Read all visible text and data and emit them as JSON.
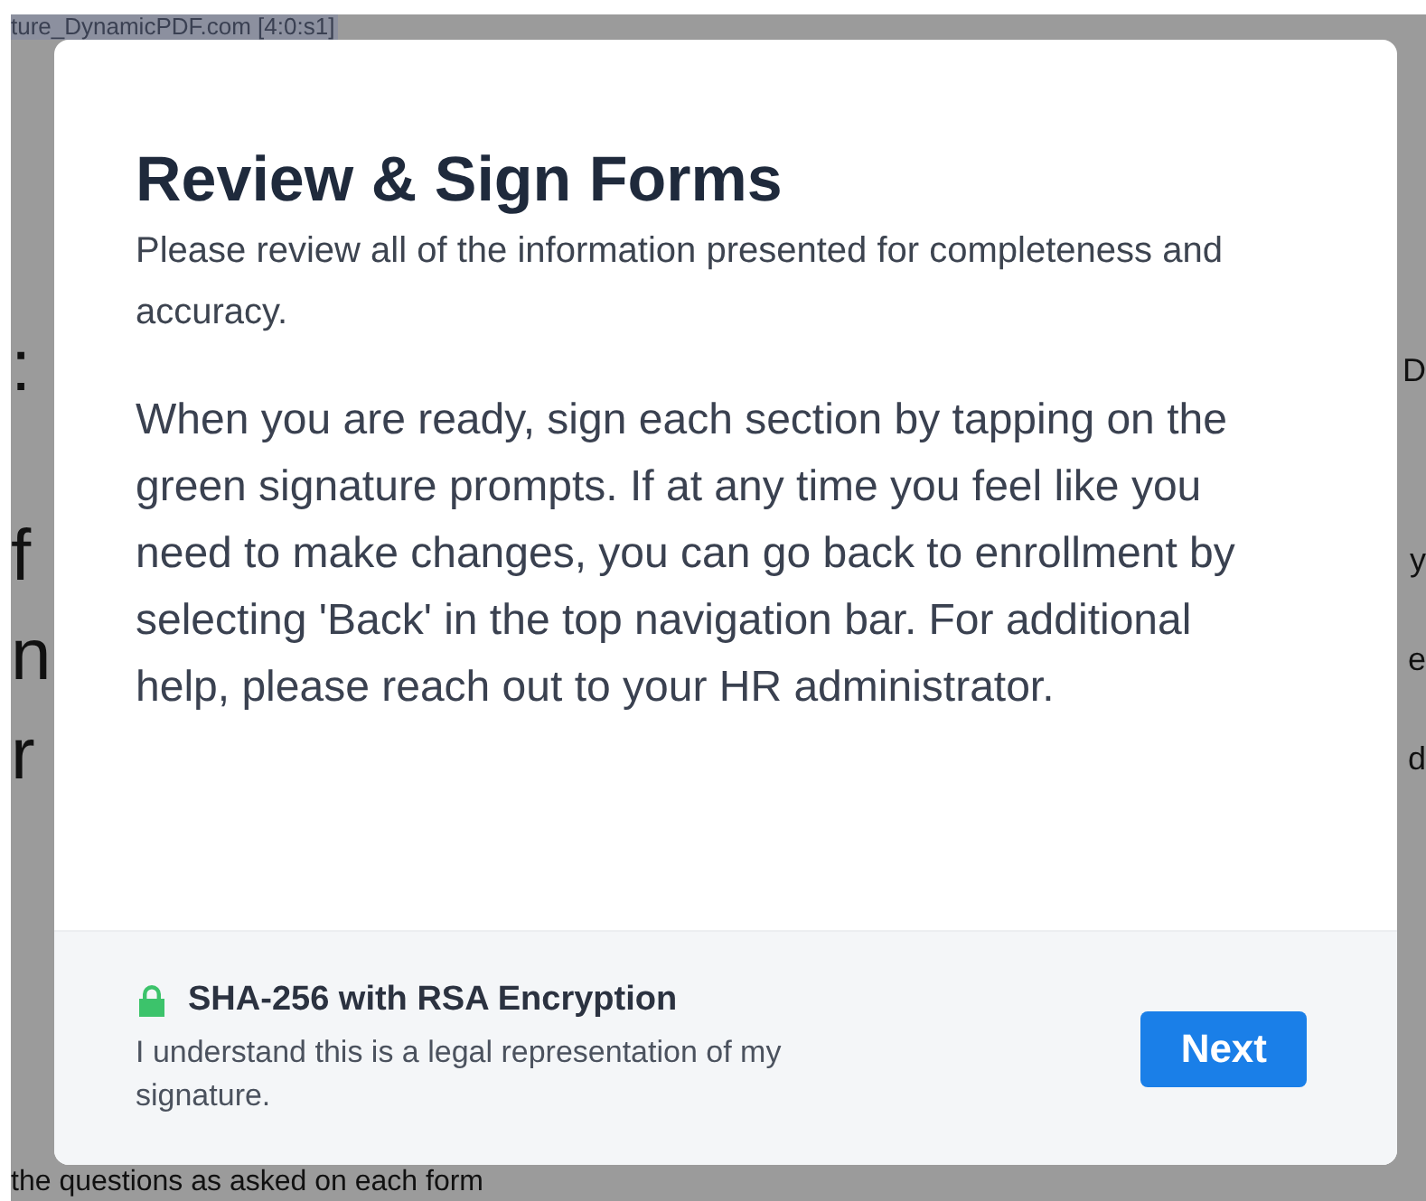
{
  "background": {
    "header": "ture_DynamicPDF.com [4:0:s1]",
    "fragments": [
      {
        "left": ":",
        "right": "D"
      },
      {
        "left": "f",
        "right": "y"
      },
      {
        "left": "n",
        "right": "e"
      },
      {
        "left": "r",
        "right": "d"
      }
    ],
    "bottom_line": "the questions as asked on each form"
  },
  "dialog": {
    "title": "Review & Sign Forms",
    "intro": "Please review all of the information presented for completeness and accuracy.",
    "body": "When you are ready, sign each section by tapping on the green signature prompts. If at any time you feel like you need to make changes, you can go back to enrollment by selecting 'Back' in the top navigation bar. For additional help, please reach out to your HR administrator.",
    "footer": {
      "security": "SHA-256 with RSA Encryption",
      "consent": "I understand this is a legal representation of my signature.",
      "button": "Next"
    }
  }
}
